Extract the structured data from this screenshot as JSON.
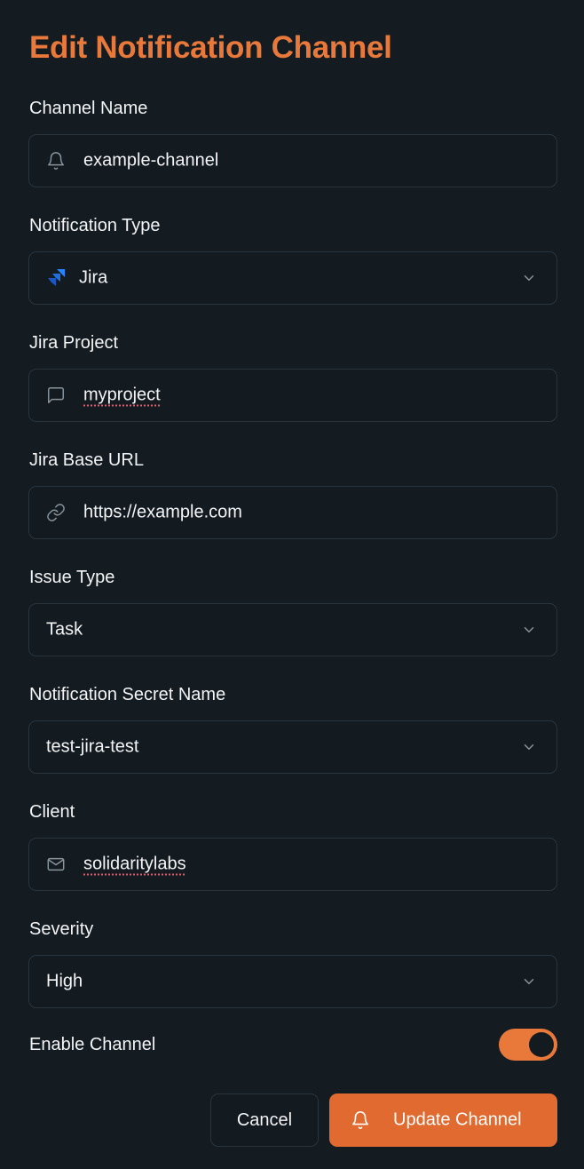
{
  "title": "Edit Notification Channel",
  "fields": {
    "channel_name": {
      "label": "Channel Name",
      "value": "example-channel",
      "icon": "bell-icon"
    },
    "notification_type": {
      "label": "Notification Type",
      "value": "Jira",
      "icon": "jira-logo-icon"
    },
    "jira_project": {
      "label": "Jira Project",
      "value": "myproject",
      "icon": "message-square-icon"
    },
    "jira_base_url": {
      "label": "Jira Base URL",
      "value": "https://example.com",
      "icon": "link-icon"
    },
    "issue_type": {
      "label": "Issue Type",
      "value": "Task"
    },
    "secret_name": {
      "label": "Notification Secret Name",
      "value": "test-jira-test"
    },
    "client": {
      "label": "Client",
      "value": "solidaritylabs",
      "icon": "mail-icon"
    },
    "severity": {
      "label": "Severity",
      "value": "High"
    }
  },
  "enable_channel": {
    "label": "Enable Channel",
    "enabled": true
  },
  "actions": {
    "cancel_label": "Cancel",
    "update_label": "Update Channel"
  },
  "colors": {
    "background": "#141c22",
    "accent": "#e9793a",
    "button_primary": "#e06a2f",
    "border": "#2b343b",
    "jira_blue": "#2684ff"
  }
}
